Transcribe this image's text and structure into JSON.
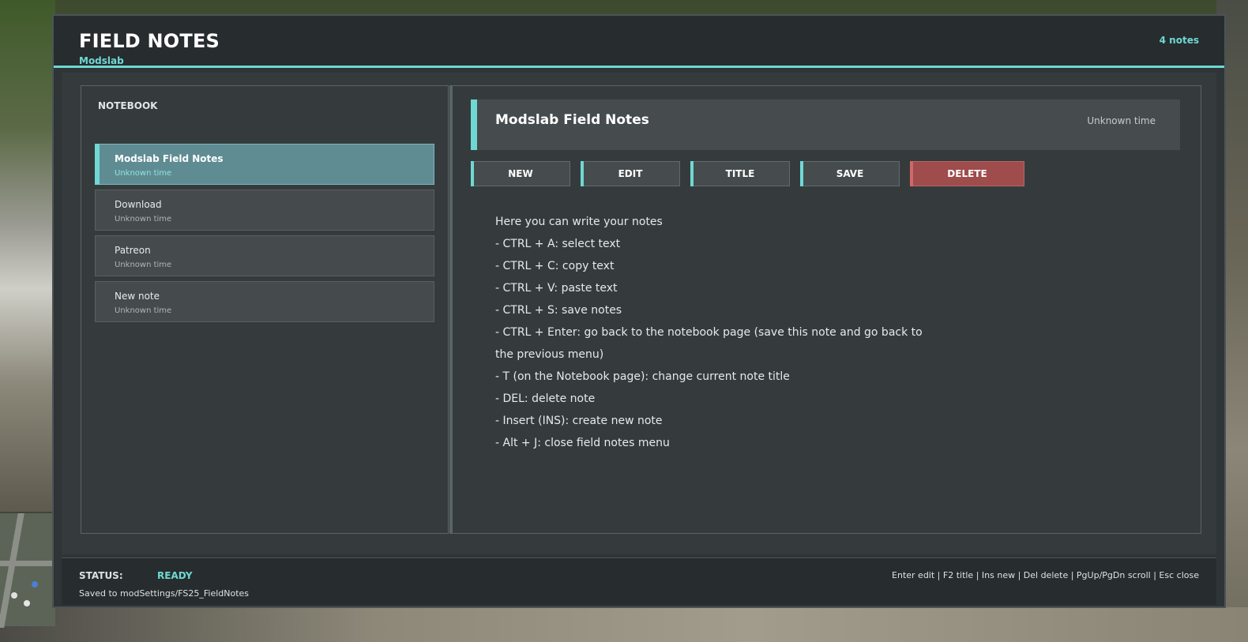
{
  "app": {
    "title": "FIELD NOTES",
    "subtitle": "Modslab",
    "note_count": "4 notes"
  },
  "sidebar": {
    "title": "NOTEBOOK",
    "items": [
      {
        "label": "Modslab Field Notes",
        "time": "Unknown time",
        "active": true
      },
      {
        "label": "Download",
        "time": "Unknown time",
        "active": false
      },
      {
        "label": "Patreon",
        "time": "Unknown time",
        "active": false
      },
      {
        "label": "New note",
        "time": "Unknown time",
        "active": false
      }
    ]
  },
  "editor": {
    "title": "Modslab Field Notes",
    "time": "Unknown time",
    "buttons": {
      "new": "NEW",
      "edit": "EDIT",
      "title": "TITLE",
      "save": "SAVE",
      "delete": "DELETE"
    },
    "content_lines": [
      "Here you can write your notes",
      "- CTRL + A: select text",
      "- CTRL + C: copy text",
      "- CTRL + V: paste text",
      "- CTRL + S: save notes",
      "- CTRL + Enter: go back to the notebook page (save this note and go back to",
      "the previous menu)",
      "- T (on the Notebook page): change current note title",
      "- DEL: delete note",
      "- Insert (INS): create new note",
      "- Alt + J: close field notes menu"
    ]
  },
  "footer": {
    "status_label": "STATUS:",
    "status_value": "READY",
    "save_path": "Saved to modSettings/FS25_FieldNotes",
    "shortcuts": "Enter edit | F2 title | Ins new | Del delete | PgUp/PgDn scroll | Esc close"
  },
  "colors": {
    "accent": "#6fd8d4",
    "danger": "#9e4c4c",
    "panel": "#353b3d",
    "titlebar": "#272c2e"
  }
}
